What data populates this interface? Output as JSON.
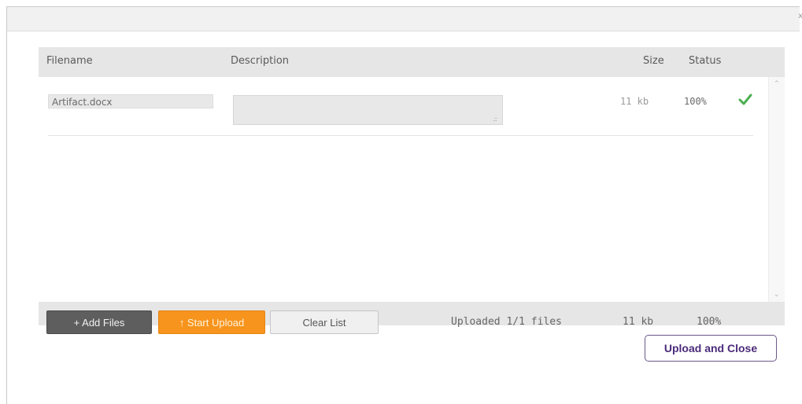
{
  "window": {
    "close_glyph": "x"
  },
  "table": {
    "headers": {
      "filename": "Filename",
      "description": "Description",
      "size": "Size",
      "status": "Status"
    },
    "rows": [
      {
        "filename": "Artifact.docx",
        "description": "",
        "size": "11 kb",
        "status": "100%",
        "status_icon": "check-icon",
        "status_color": "#4caf50"
      }
    ]
  },
  "footer": {
    "add_files_label": "+ Add Files",
    "start_upload_label": "↑ Start Upload",
    "clear_list_label": "Clear List",
    "uploaded_text": "Uploaded 1/1 files",
    "total_size": "11 kb",
    "total_percent": "100%"
  },
  "actions": {
    "upload_and_close_label": "Upload and Close"
  },
  "colors": {
    "start_upload_bg": "#f7941d",
    "add_files_bg": "#5e5e5e",
    "accent_purple": "#4b2b7a"
  }
}
